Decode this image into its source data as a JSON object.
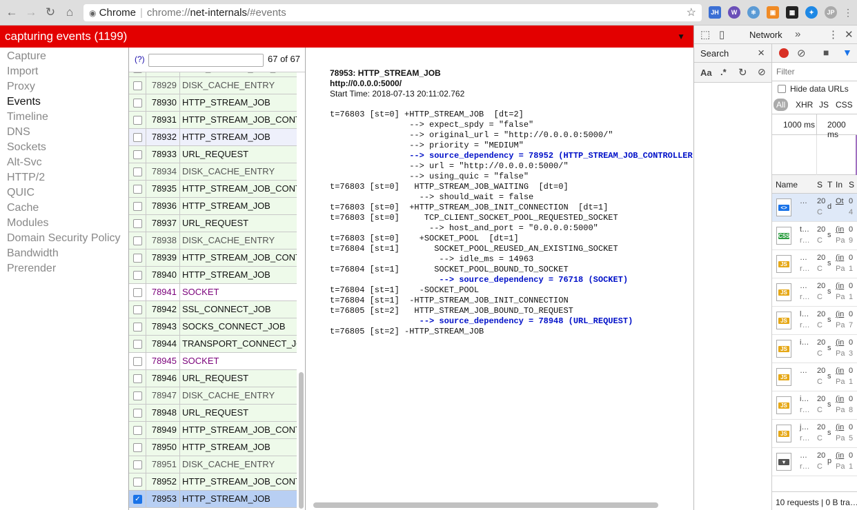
{
  "browser": {
    "tab_origin": "Chrome",
    "url_scheme": "chrome://",
    "url_host": "net-internals",
    "url_hash": "/#events",
    "extensions": [
      "JH",
      "W",
      "",
      "",
      "",
      "",
      "JP"
    ]
  },
  "status_bar": {
    "text": "capturing events (1199)"
  },
  "nav": {
    "items": [
      "Capture",
      "Import",
      "Proxy",
      "Events",
      "Timeline",
      "DNS",
      "Sockets",
      "Alt-Svc",
      "HTTP/2",
      "QUIC",
      "Cache",
      "Modules",
      "Domain Security Policy",
      "Bandwidth",
      "Prerender"
    ],
    "active": "Events"
  },
  "events": {
    "help": "(?)",
    "filter_value": "",
    "count": "67 of 67",
    "rows": [
      {
        "id": "78928",
        "type": "HTTP_STREAM_JOB_CONTROLLER",
        "style": "dim"
      },
      {
        "id": "78929",
        "type": "DISK_CACHE_ENTRY",
        "style": "dim"
      },
      {
        "id": "78930",
        "type": "HTTP_STREAM_JOB",
        "style": ""
      },
      {
        "id": "78931",
        "type": "HTTP_STREAM_JOB_CONTROLLER",
        "style": ""
      },
      {
        "id": "78932",
        "type": "HTTP_STREAM_JOB",
        "style": "sel"
      },
      {
        "id": "78933",
        "type": "URL_REQUEST",
        "style": ""
      },
      {
        "id": "78934",
        "type": "DISK_CACHE_ENTRY",
        "style": "dim"
      },
      {
        "id": "78935",
        "type": "HTTP_STREAM_JOB_CONTROLLER",
        "style": ""
      },
      {
        "id": "78936",
        "type": "HTTP_STREAM_JOB",
        "style": ""
      },
      {
        "id": "78937",
        "type": "URL_REQUEST",
        "style": ""
      },
      {
        "id": "78938",
        "type": "DISK_CACHE_ENTRY",
        "style": "dim"
      },
      {
        "id": "78939",
        "type": "HTTP_STREAM_JOB_CONTROLLER",
        "style": ""
      },
      {
        "id": "78940",
        "type": "HTTP_STREAM_JOB",
        "style": ""
      },
      {
        "id": "78941",
        "type": "SOCKET",
        "style": "socket"
      },
      {
        "id": "78942",
        "type": "SSL_CONNECT_JOB",
        "style": ""
      },
      {
        "id": "78943",
        "type": "SOCKS_CONNECT_JOB",
        "style": ""
      },
      {
        "id": "78944",
        "type": "TRANSPORT_CONNECT_JOB",
        "style": ""
      },
      {
        "id": "78945",
        "type": "SOCKET",
        "style": "socket"
      },
      {
        "id": "78946",
        "type": "URL_REQUEST",
        "style": ""
      },
      {
        "id": "78947",
        "type": "DISK_CACHE_ENTRY",
        "style": "dim"
      },
      {
        "id": "78948",
        "type": "URL_REQUEST",
        "style": ""
      },
      {
        "id": "78949",
        "type": "HTTP_STREAM_JOB_CONTROLLER",
        "style": ""
      },
      {
        "id": "78950",
        "type": "HTTP_STREAM_JOB",
        "style": ""
      },
      {
        "id": "78951",
        "type": "DISK_CACHE_ENTRY",
        "style": "dim"
      },
      {
        "id": "78952",
        "type": "HTTP_STREAM_JOB_CONTROLLER",
        "style": ""
      },
      {
        "id": "78953",
        "type": "HTTP_STREAM_JOB",
        "style": "checked"
      }
    ]
  },
  "details": {
    "title": "78953: HTTP_STREAM_JOB",
    "url": "http://0.0.0.0:5000/",
    "start_time": "Start Time: 2018-07-13 20:11:02.762",
    "log": [
      {
        "text": "t=76803 [st=0] +HTTP_STREAM_JOB  [dt=2]",
        "link": false
      },
      {
        "text": "                --> expect_spdy = \"false\"",
        "link": false
      },
      {
        "text": "                --> original_url = \"http://0.0.0.0:5000/\"",
        "link": false
      },
      {
        "text": "                --> priority = \"MEDIUM\"",
        "link": false
      },
      {
        "text": "                --> source_dependency = 78952 (HTTP_STREAM_JOB_CONTROLLER)",
        "link": true
      },
      {
        "text": "                --> url = \"http://0.0.0.0:5000/\"",
        "link": false
      },
      {
        "text": "                --> using_quic = \"false\"",
        "link": false
      },
      {
        "text": "t=76803 [st=0]   HTTP_STREAM_JOB_WAITING  [dt=0]",
        "link": false
      },
      {
        "text": "                  --> should_wait = false",
        "link": false
      },
      {
        "text": "t=76803 [st=0]  +HTTP_STREAM_JOB_INIT_CONNECTION  [dt=1]",
        "link": false
      },
      {
        "text": "t=76803 [st=0]     TCP_CLIENT_SOCKET_POOL_REQUESTED_SOCKET",
        "link": false
      },
      {
        "text": "                    --> host_and_port = \"0.0.0.0:5000\"",
        "link": false
      },
      {
        "text": "t=76803 [st=0]    +SOCKET_POOL  [dt=1]",
        "link": false
      },
      {
        "text": "t=76804 [st=1]       SOCKET_POOL_REUSED_AN_EXISTING_SOCKET",
        "link": false
      },
      {
        "text": "                      --> idle_ms = 14963",
        "link": false
      },
      {
        "text": "t=76804 [st=1]       SOCKET_POOL_BOUND_TO_SOCKET",
        "link": false
      },
      {
        "text": "                      --> source_dependency = 76718 (SOCKET)",
        "link": true
      },
      {
        "text": "t=76804 [st=1]    -SOCKET_POOL",
        "link": false
      },
      {
        "text": "t=76804 [st=1]  -HTTP_STREAM_JOB_INIT_CONNECTION",
        "link": false
      },
      {
        "text": "t=76805 [st=2]   HTTP_STREAM_JOB_BOUND_TO_REQUEST",
        "link": false
      },
      {
        "text": "                  --> source_dependency = 78948 (URL_REQUEST)",
        "link": true
      },
      {
        "text": "t=76805 [st=2] -HTTP_STREAM_JOB",
        "link": false
      }
    ]
  },
  "devtools": {
    "network_tab": "Network",
    "more": "»",
    "search_label": "Search",
    "case_label": "Aa",
    "regex_label": ".*",
    "filter_placeholder": "Filter",
    "hide_data_urls": "Hide data URLs",
    "types": [
      "All",
      "XHR",
      "JS",
      "CSS"
    ],
    "timeline": [
      "1000 ms",
      "2000 ms"
    ],
    "columns": [
      "Name",
      "S",
      "T",
      "In",
      "S"
    ],
    "requests": [
      {
        "icon": "html",
        "l1": "…",
        "l2": "",
        "s1": "20",
        "s2": "C",
        "t": "d",
        "i1": "Ot",
        "i2": "",
        "z1": "0",
        "z2": "4"
      },
      {
        "icon": "css",
        "l1": "t…",
        "l2": "r…",
        "s1": "20",
        "s2": "C",
        "t": "s",
        "i1": "(in",
        "i2": "Pa",
        "z1": "0",
        "z2": "9"
      },
      {
        "icon": "js",
        "l1": "…",
        "l2": "r…",
        "s1": "20",
        "s2": "C",
        "t": "s",
        "i1": "(in",
        "i2": "Pa",
        "z1": "0",
        "z2": "1"
      },
      {
        "icon": "js",
        "l1": "…",
        "l2": "r…",
        "s1": "20",
        "s2": "C",
        "t": "s",
        "i1": "(in",
        "i2": "Pa",
        "z1": "0",
        "z2": "1"
      },
      {
        "icon": "js",
        "l1": "l…",
        "l2": "r…",
        "s1": "20",
        "s2": "C",
        "t": "s",
        "i1": "(in",
        "i2": "Pa",
        "z1": "0",
        "z2": "7"
      },
      {
        "icon": "js",
        "l1": "i…",
        "l2": "",
        "s1": "20",
        "s2": "C",
        "t": "s",
        "i1": "(in",
        "i2": "Pa",
        "z1": "0",
        "z2": "3"
      },
      {
        "icon": "js",
        "l1": "…",
        "l2": "",
        "s1": "20",
        "s2": "C",
        "t": "s",
        "i1": "(in",
        "i2": "Pa",
        "z1": "0",
        "z2": "1"
      },
      {
        "icon": "js",
        "l1": "i…",
        "l2": "r…",
        "s1": "20",
        "s2": "C",
        "t": "s",
        "i1": "(in",
        "i2": "Pa",
        "z1": "0",
        "z2": "8"
      },
      {
        "icon": "js",
        "l1": "j…",
        "l2": "r…",
        "s1": "20",
        "s2": "C",
        "t": "s",
        "i1": "(in",
        "i2": "Pa",
        "z1": "0",
        "z2": "5"
      },
      {
        "icon": "other",
        "l1": "…",
        "l2": "r…",
        "s1": "20",
        "s2": "C",
        "t": "p",
        "i1": "(in",
        "i2": "Pa",
        "z1": "0",
        "z2": "1"
      }
    ],
    "status": "10 requests | 0 B tra…"
  },
  "colors": {
    "status_red": "#e30000",
    "row_green": "#eefaea",
    "row_checked": "#b8cff3",
    "link_blue": "#0010c8",
    "socket_purple": "#7a007a",
    "record_red": "#d93025"
  }
}
